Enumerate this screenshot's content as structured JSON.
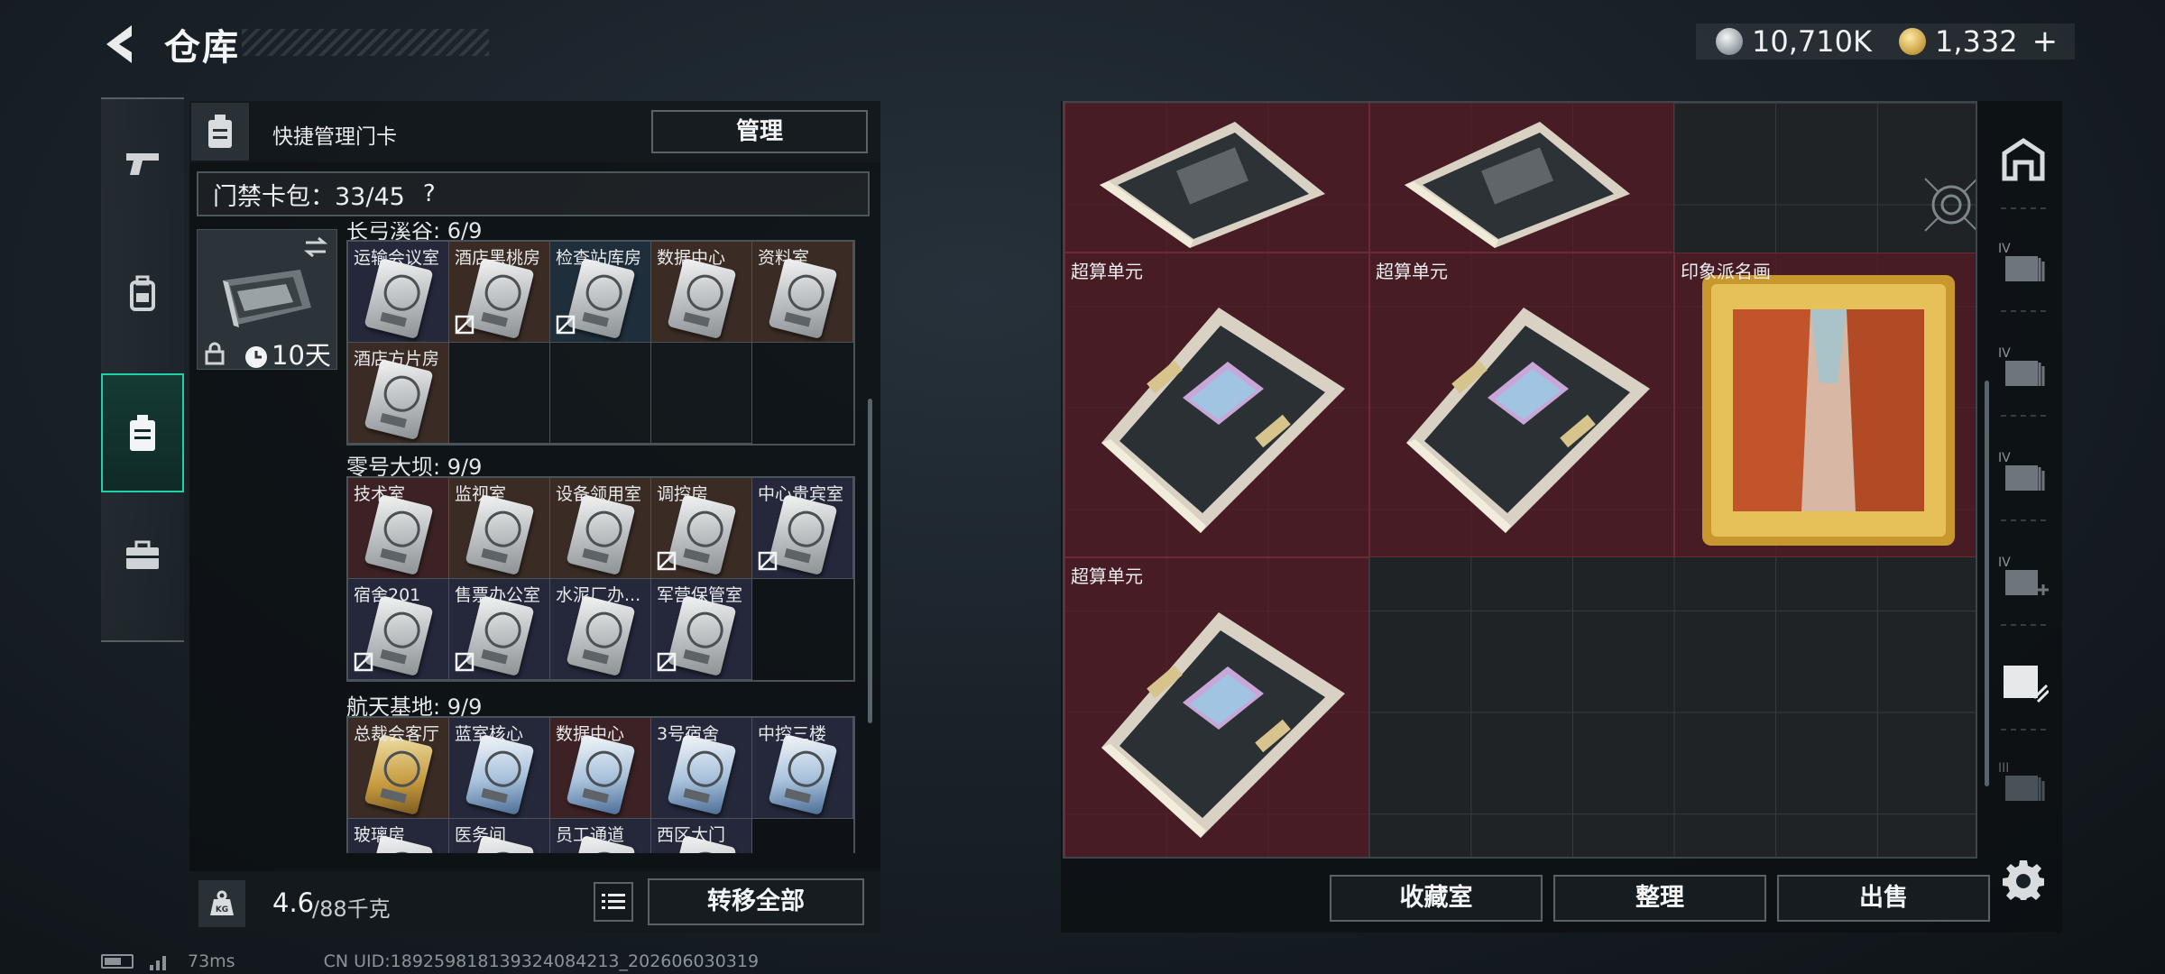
{
  "header": {
    "title": "仓库",
    "currency": [
      {
        "icon": "silver-coin-icon",
        "value": "10,710K"
      },
      {
        "icon": "gold-coin-icon",
        "value": "1,332"
      }
    ],
    "add_label": "+"
  },
  "left_nav": [
    {
      "icon": "pistol-icon",
      "active": false
    },
    {
      "icon": "backpack-icon",
      "active": false
    },
    {
      "icon": "keycard-holder-icon",
      "active": true
    },
    {
      "icon": "briefcase-icon",
      "active": false
    }
  ],
  "card_panel": {
    "header_label": "快捷管理门卡",
    "manage_button": "管理",
    "cardpack_label": "门禁卡包：33/45",
    "cardpack_help": "?",
    "cardpack_days": "10天",
    "sections": [
      {
        "title": "长弓溪谷: 6/9",
        "cards": [
          {
            "name": "运输会议室",
            "color": "navy",
            "no_fee": false
          },
          {
            "name": "酒店黑桃房",
            "color": "brown",
            "no_fee": true
          },
          {
            "name": "检查站库房",
            "color": "teal",
            "no_fee": true
          },
          {
            "name": "数据中心",
            "color": "brown",
            "no_fee": false
          },
          {
            "name": "资料室",
            "color": "brown",
            "no_fee": false
          },
          {
            "name": "酒店方片房",
            "color": "brown",
            "no_fee": false
          }
        ],
        "empty_slots": 3
      },
      {
        "title": "零号大坝: 9/9",
        "cards": [
          {
            "name": "技术室",
            "color": "red",
            "no_fee": false
          },
          {
            "name": "监视室",
            "color": "brown",
            "no_fee": false
          },
          {
            "name": "设备领用室",
            "color": "brown",
            "no_fee": false
          },
          {
            "name": "调控房",
            "color": "brown",
            "no_fee": true
          },
          {
            "name": "中心贵宾室",
            "color": "navy",
            "no_fee": true
          },
          {
            "name": "宿舍201",
            "color": "navy",
            "no_fee": true
          },
          {
            "name": "售票办公室",
            "color": "navy",
            "no_fee": true
          },
          {
            "name": "水泥厂办...",
            "color": "navy",
            "no_fee": false
          },
          {
            "name": "军营保管室",
            "color": "navy",
            "no_fee": true
          }
        ],
        "empty_slots": 0
      },
      {
        "title": "航天基地: 9/9",
        "cards": [
          {
            "name": "总裁会客厅",
            "color": "brown",
            "style": "gold",
            "no_fee": false
          },
          {
            "name": "蓝室核心",
            "color": "navy",
            "style": "blue",
            "no_fee": false
          },
          {
            "name": "数据中心",
            "color": "red",
            "style": "blue",
            "no_fee": false
          },
          {
            "name": "3号宿舍",
            "color": "navy",
            "style": "blue",
            "no_fee": false
          },
          {
            "name": "中控三楼",
            "color": "navy",
            "style": "blue",
            "no_fee": false
          },
          {
            "name": "玻璃房",
            "color": "navy",
            "style": "silver",
            "no_fee": false
          },
          {
            "name": "医务间",
            "color": "navy",
            "style": "silver",
            "no_fee": false
          },
          {
            "name": "员工通道",
            "color": "navy",
            "style": "silver",
            "no_fee": false
          },
          {
            "name": "西区大门",
            "color": "navy",
            "style": "silver",
            "no_fee": false
          }
        ],
        "empty_slots": 0
      }
    ],
    "weight_current": "4.6",
    "weight_max": "/88千克",
    "transfer_all_button": "转移全部"
  },
  "storage": {
    "items": [
      {
        "label": "",
        "type": "chip"
      },
      {
        "label": "",
        "type": "chip"
      },
      {
        "label": "超算单元",
        "type": "chip"
      },
      {
        "label": "超算单元",
        "type": "chip"
      },
      {
        "label": "印象派名画",
        "type": "painting"
      },
      {
        "label": "超算单元",
        "type": "chip"
      }
    ],
    "buttons": {
      "collection": "收藏室",
      "sort": "整理",
      "sell": "出售"
    }
  },
  "right_tabs": [
    {
      "icon": "vault-icon",
      "badge": ""
    },
    {
      "icon": "stash-tier-icon",
      "badge": "IV"
    },
    {
      "icon": "stash-tier-icon",
      "badge": "IV"
    },
    {
      "icon": "stash-tier-icon",
      "badge": "IV"
    },
    {
      "icon": "stash-add-icon",
      "badge": "IV"
    },
    {
      "icon": "stash-special-icon",
      "badge": ""
    },
    {
      "icon": "stash-tier-icon",
      "badge": "III"
    }
  ],
  "status": {
    "ping": "73ms",
    "uid": "CN UID:18925981813932408421​3_202606030319"
  },
  "colors": {
    "accent": "#1fd1a4",
    "item_bg": "#581a24",
    "panel_bg": "#0b0f12"
  }
}
